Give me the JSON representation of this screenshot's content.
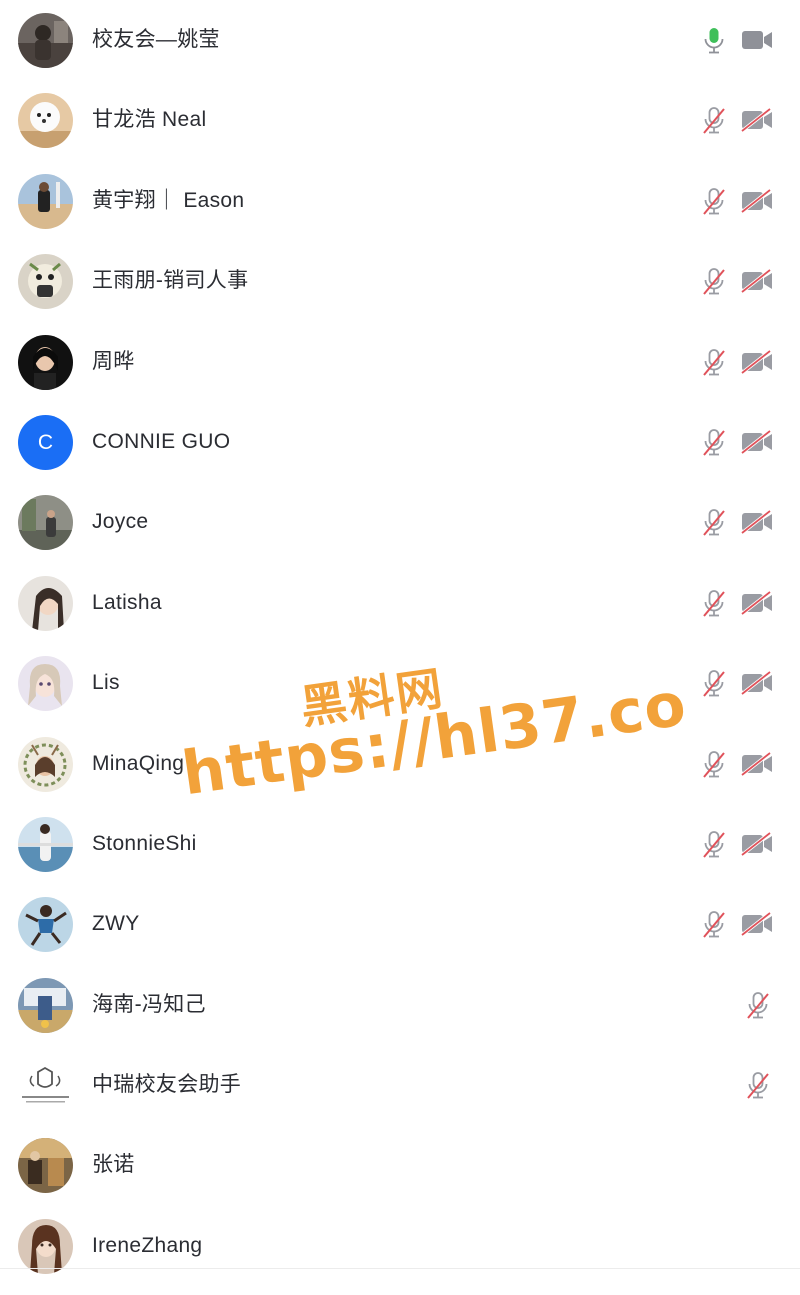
{
  "participants": [
    {
      "name": "校友会—姚莹",
      "avatar_icon": "avatar-photo-dark",
      "mic": "on",
      "camera": "off-neutral",
      "mic_color": "#3fbf5a"
    },
    {
      "name": "甘龙浩 Neal",
      "avatar_icon": "avatar-photo-dog",
      "mic": "muted",
      "camera": "muted"
    },
    {
      "name": "黄宇翔｜ Eason",
      "avatar_icon": "avatar-photo-beach",
      "mic": "muted",
      "camera": "muted"
    },
    {
      "name": "王雨朋-销司人事",
      "avatar_icon": "avatar-photo-cartoon",
      "mic": "muted",
      "camera": "muted"
    },
    {
      "name": "周晔",
      "avatar_icon": "avatar-photo-portrait",
      "mic": "muted",
      "camera": "muted"
    },
    {
      "name": "CONNIE GUO",
      "avatar_icon": "avatar-initial",
      "avatar_initial": "C",
      "avatar_color": "#1a6ef5",
      "mic": "muted",
      "camera": "muted"
    },
    {
      "name": "Joyce",
      "avatar_icon": "avatar-photo-street",
      "mic": "muted",
      "camera": "muted"
    },
    {
      "name": "Latisha",
      "avatar_icon": "avatar-photo-girl",
      "mic": "muted",
      "camera": "muted"
    },
    {
      "name": "Lis",
      "avatar_icon": "avatar-photo-anime",
      "mic": "muted",
      "camera": "muted"
    },
    {
      "name": "MinaQing",
      "avatar_icon": "avatar-photo-wreath",
      "mic": "muted",
      "camera": "muted"
    },
    {
      "name": "StonnieShi",
      "avatar_icon": "avatar-photo-sea",
      "mic": "muted",
      "camera": "muted"
    },
    {
      "name": "ZWY",
      "avatar_icon": "avatar-photo-jump",
      "mic": "muted",
      "camera": "muted"
    },
    {
      "name": "海南-冯知己",
      "avatar_icon": "avatar-photo-room",
      "mic": "muted",
      "camera": "none"
    },
    {
      "name": "中瑞校友会助手",
      "avatar_icon": "avatar-logo-emblem",
      "mic": "muted",
      "camera": "none"
    },
    {
      "name": "张诺",
      "avatar_icon": "avatar-photo-interior",
      "mic": "none",
      "camera": "none"
    },
    {
      "name": "IreneZhang",
      "avatar_icon": "avatar-photo-woman",
      "mic": "none",
      "camera": "none"
    }
  ],
  "watermark": {
    "title": "黑料网",
    "url": "https://hl37.co",
    "color": "#f2a23a"
  },
  "colors": {
    "muted_slash": "#e0525a",
    "icon_gray": "#9a9ca3",
    "mic_on": "#3fbf5a"
  }
}
